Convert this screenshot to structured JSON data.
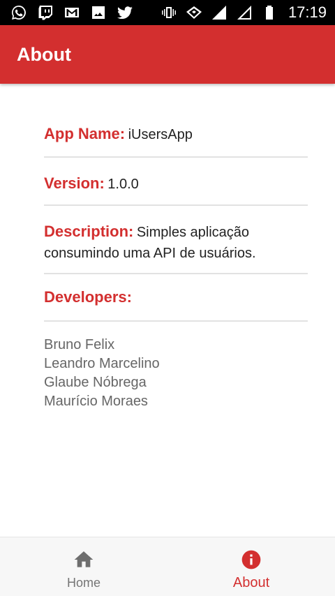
{
  "status_bar": {
    "time": "17:19",
    "left_icons": [
      "whatsapp-icon",
      "twitch-icon",
      "gmail-icon",
      "gallery-icon",
      "twitter-icon"
    ],
    "right_icons": [
      "vibrate-icon",
      "wifi-icon",
      "signal-icon",
      "signal-icon",
      "battery-icon"
    ]
  },
  "app_bar": {
    "title": "About"
  },
  "about": {
    "app_name_label": "App Name:",
    "app_name_value": "iUsersApp",
    "version_label": "Version:",
    "version_value": "1.0.0",
    "description_label": "Description:",
    "description_value": "Simples aplicação consumindo uma API de usuários.",
    "developers_label": "Developers:",
    "developers": [
      "Bruno Felix",
      "Leandro Marcelino",
      "Glaube Nóbrega",
      "Maurício Moraes"
    ]
  },
  "bottom_nav": {
    "items": [
      {
        "label": "Home",
        "icon": "home-icon",
        "active": false
      },
      {
        "label": "About",
        "icon": "info-icon",
        "active": true
      }
    ]
  },
  "colors": {
    "primary": "#d32f2f",
    "status_bar": "#000000",
    "inactive_nav": "#757575",
    "developer_text": "#666666"
  }
}
